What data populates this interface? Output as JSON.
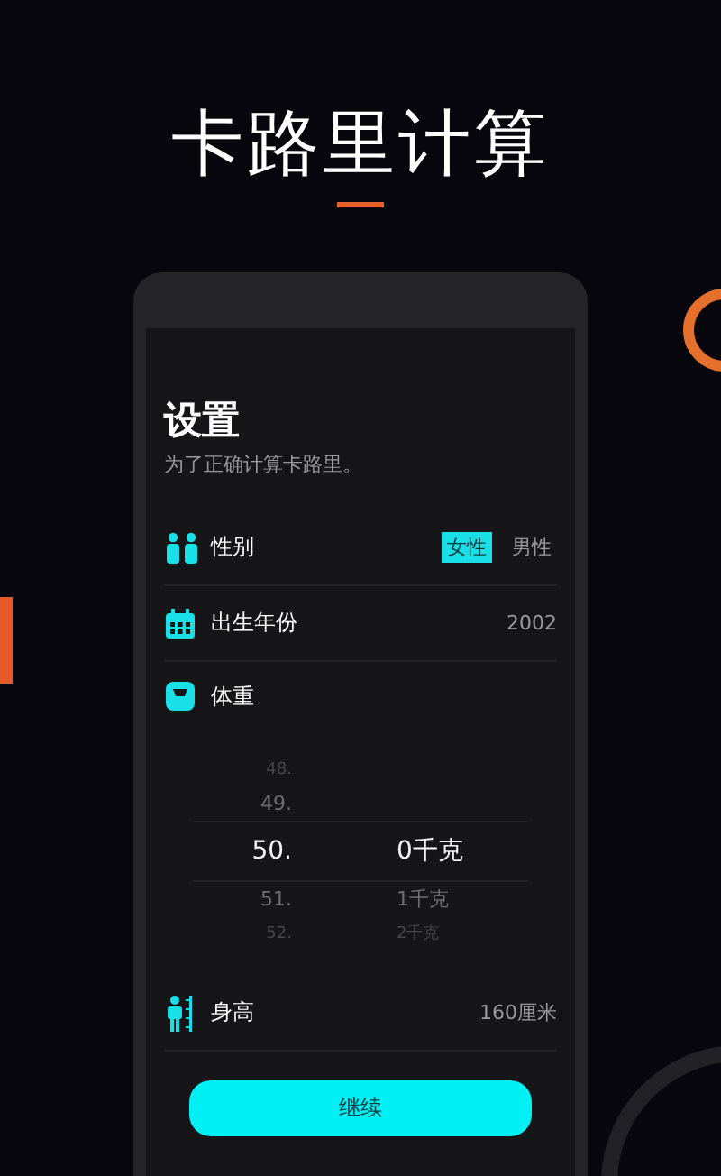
{
  "headline": "卡路里计算",
  "settings": {
    "title": "设置",
    "subtitle": "为了正确计算卡路里。",
    "rows": [
      {
        "kind": "gender",
        "label": "性别",
        "options": [
          {
            "label": "女性",
            "selected": true
          },
          {
            "label": "男性",
            "selected": false
          }
        ]
      },
      {
        "kind": "value",
        "label": "出生年份",
        "value": "2002"
      },
      {
        "kind": "picker",
        "label": "体重",
        "whole": [
          {
            "label": "48.",
            "selected": false
          },
          {
            "label": "49.",
            "selected": false
          },
          {
            "label": "50.",
            "selected": true
          },
          {
            "label": "51.",
            "selected": false
          },
          {
            "label": "52.",
            "selected": false
          }
        ],
        "fraction": [
          {
            "label": "0千克",
            "selected": true
          },
          {
            "label": "1千克",
            "selected": false
          },
          {
            "label": "2千克",
            "selected": false
          }
        ]
      },
      {
        "kind": "value",
        "label": "身高",
        "value": "160厘米"
      }
    ],
    "button": "继续"
  }
}
